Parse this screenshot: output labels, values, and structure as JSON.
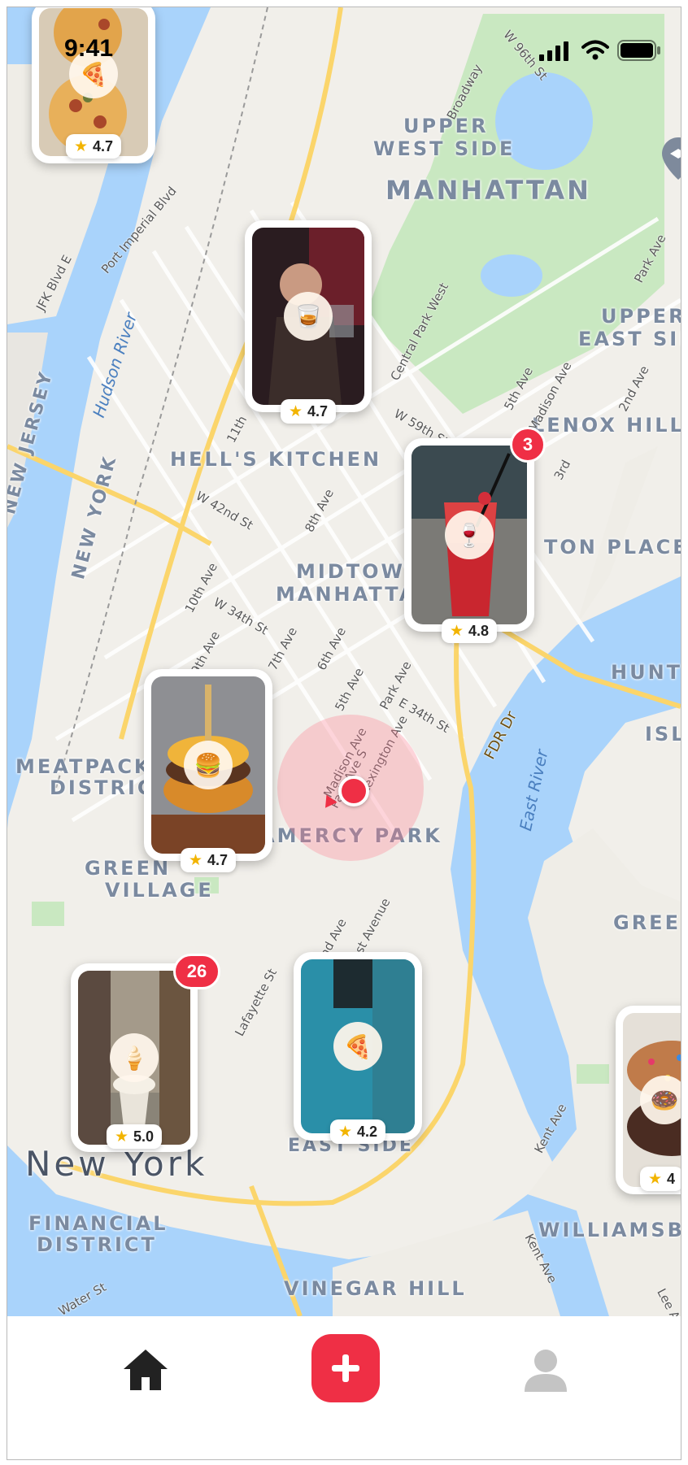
{
  "status_bar": {
    "time": "9:41"
  },
  "map": {
    "area_labels": [
      {
        "text": "UPPER",
        "size": 24
      },
      {
        "text": "WEST SIDE",
        "size": 24
      },
      {
        "text": "MANHATTAN",
        "size": 30
      },
      {
        "text": "HELL'S KITCHEN",
        "size": 24
      },
      {
        "text": "MIDTOWN",
        "size": 24
      },
      {
        "text": "MANHATTAN",
        "size": 24
      },
      {
        "text": "LENOX HILL",
        "size": 24
      },
      {
        "text": "UPPER",
        "size": 24
      },
      {
        "text": "EAST SID",
        "size": 24
      },
      {
        "text": "TON PLACE",
        "size": 24
      },
      {
        "text": "HUNTE",
        "size": 24
      },
      {
        "text": "ISL",
        "size": 24
      },
      {
        "text": "MEATPACK",
        "size": 24
      },
      {
        "text": "DISTRIC",
        "size": 24
      },
      {
        "text": "GREEN",
        "size": 24
      },
      {
        "text": "VILLAGE",
        "size": 24
      },
      {
        "text": "AMERCY PARK",
        "size": 24
      },
      {
        "text": "GREEN",
        "size": 24
      },
      {
        "text": "New York",
        "size": 42
      },
      {
        "text": "FINANCIAL",
        "size": 24
      },
      {
        "text": "DISTRICT",
        "size": 24
      },
      {
        "text": "WILLIAMSBU",
        "size": 24
      },
      {
        "text": "VINEGAR HILL",
        "size": 24
      },
      {
        "text": "EAST SIDE",
        "size": 22
      },
      {
        "text": "NEW JERSEY",
        "size": 22
      },
      {
        "text": "NEW YORK",
        "size": 22
      }
    ],
    "street_labels": [
      "W 96th St",
      "Broadway",
      "Central Park West",
      "W 59th St",
      "W 42nd St",
      "10th Ave",
      "W 34th St",
      "9th Ave",
      "7th Ave",
      "8th Ave",
      "6th Ave",
      "5th Ave",
      "Madison Ave",
      "Park Ave",
      "Park Ave S",
      "Lexington Ave",
      "E 34th St",
      "2nd Ave",
      "1st Avenue",
      "Lafayette St",
      "FDR Dr",
      "Water St",
      "JFK Blvd E",
      "Port Imperial Blvd",
      "Kent Ave",
      "Lee Av",
      "11th",
      "2nd Ave",
      "3rd",
      "Park Ave",
      "Madison Ave",
      "5th Ave",
      "Kent Ave"
    ],
    "water_labels": [
      "Hudson River",
      "East River"
    ]
  },
  "pins": [
    {
      "id": "pin-pizza-top",
      "rating": "4.7",
      "icon": "pizza-icon",
      "glyph": "🍕"
    },
    {
      "id": "pin-drinks",
      "rating": "4.7",
      "icon": "whiskey-icon",
      "glyph": "🥃"
    },
    {
      "id": "pin-cocktail",
      "rating": "4.8",
      "icon": "wine-icon",
      "glyph": "🍷",
      "badge": "3"
    },
    {
      "id": "pin-burger",
      "rating": "4.7",
      "icon": "burger-icon",
      "glyph": "🍔"
    },
    {
      "id": "pin-icecream",
      "rating": "5.0",
      "icon": "ice-cream-icon",
      "glyph": "🍦",
      "badge": "26"
    },
    {
      "id": "pin-pizza-blue",
      "rating": "4.2",
      "icon": "pizza-icon",
      "glyph": "🍕"
    },
    {
      "id": "pin-donut",
      "rating": "4",
      "icon": "donut-icon",
      "glyph": "🍩"
    }
  ],
  "tab_bar": {
    "items": [
      {
        "name": "home",
        "icon": "home-icon",
        "active": true
      },
      {
        "name": "add",
        "icon": "plus-icon"
      },
      {
        "name": "profile",
        "icon": "profile-icon"
      }
    ]
  },
  "colors": {
    "accent": "#ef2f45",
    "water": "#a9d3fb",
    "park": "#c9e8c1",
    "star": "#f2b400"
  }
}
